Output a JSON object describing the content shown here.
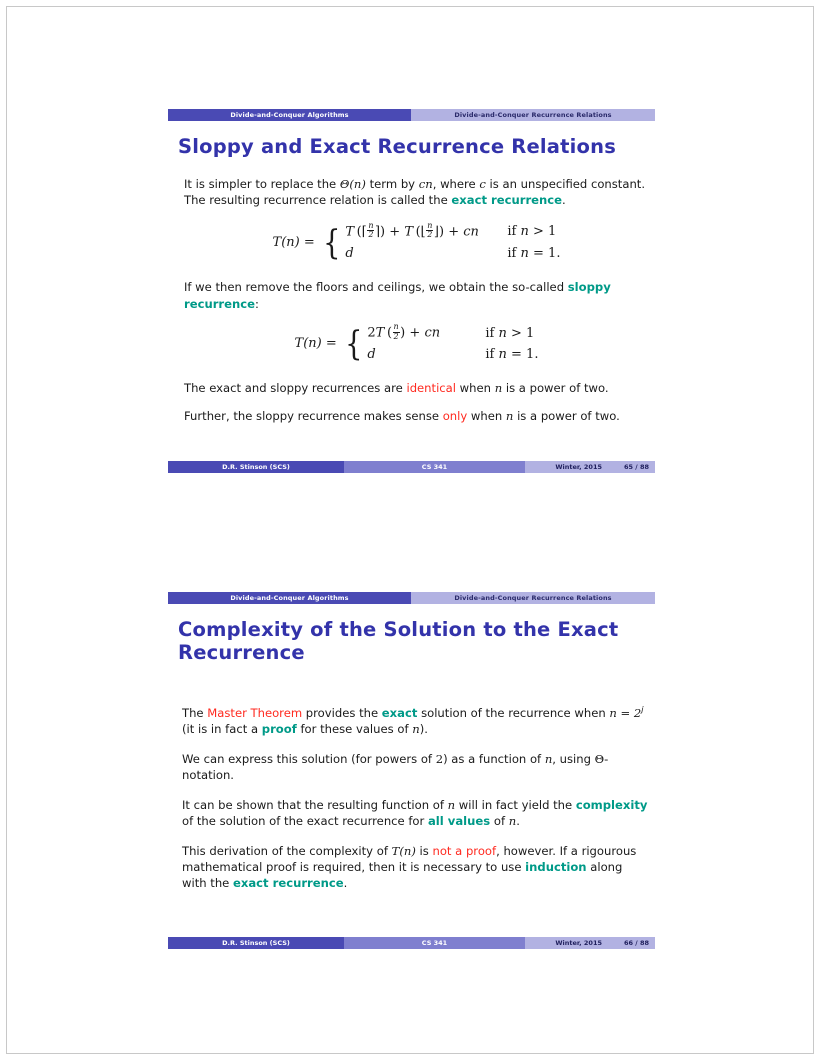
{
  "document": {
    "type": "lecture-slides",
    "colors": {
      "nav_active": "#4a4ab4",
      "nav_inactive": "#b2b2e2",
      "footer_author": "#4a4ab4",
      "footer_course": "#7f7fcf",
      "footer_right": "#b2b2e2",
      "title": "#3333aa",
      "highlight_teal": "#009a88",
      "highlight_red": "#ff2a20"
    }
  },
  "slide1": {
    "nav": {
      "active_label": "Divide-and-Conquer Algorithms",
      "inactive_label": "Divide-and-Conquer Recurrence Relations"
    },
    "title": "Sloppy and Exact Recurrence Relations",
    "para1": {
      "seg1": "It is simpler to replace the ",
      "theta": "Θ(n)",
      "seg2": " term by ",
      "cn": "cn",
      "seg3": ", where ",
      "c": "c",
      "seg4": " is an unspecified constant. The resulting recurrence relation is called the ",
      "highlight": "exact recurrence",
      "seg5": "."
    },
    "equation_exact": {
      "lhs": "T(n) =",
      "case1": "T (⌈n/2⌉) + T (⌊n/2⌋) + cn",
      "cond1": "if n > 1",
      "case2": "d",
      "cond2": "if n = 1.",
      "T": "T",
      "plus": "+",
      "cn": "cn",
      "d": "d",
      "lceil": "⌈",
      "rceil": "⌉",
      "lfloor": "⌊",
      "rfloor": "⌋",
      "num": "n",
      "den": "2",
      "if": "if",
      "n": "n",
      "gt": "> 1",
      "eq": "= 1."
    },
    "para2": {
      "seg1": "If we then remove the floors and ceilings, we obtain the so-called ",
      "highlight": "sloppy recurrence",
      "seg2": ":"
    },
    "equation_sloppy": {
      "lhs": "T(n) =",
      "case1": "2 T (n/2) + cn",
      "cond1": "if n > 1",
      "case2": "d",
      "cond2": "if n = 1.",
      "two": "2",
      "T": "T",
      "plus": "+",
      "cn": "cn",
      "d": "d",
      "num": "n",
      "den": "2",
      "if": "if",
      "n": "n",
      "gt": "> 1",
      "eq": "= 1."
    },
    "para3": {
      "seg1": "The exact and sloppy recurrences are ",
      "highlight": "identical",
      "seg2": " when ",
      "n": "n",
      "seg3": " is a power of two."
    },
    "para4": {
      "seg1": "Further, the sloppy recurrence makes sense ",
      "highlight": "only",
      "seg2": " when ",
      "n": "n",
      "seg3": " is a power of two."
    },
    "footer": {
      "author": "D.R. Stinson  (SCS)",
      "course": "CS 341",
      "term": "Winter, 2015",
      "page": "65 / 88"
    }
  },
  "slide2": {
    "nav": {
      "active_label": "Divide-and-Conquer Algorithms",
      "inactive_label": "Divide-and-Conquer Recurrence Relations"
    },
    "title": "Complexity of the Solution to the Exact Recurrence",
    "para1": {
      "seg1": "The ",
      "red": "Master Theorem",
      "seg2": " provides the ",
      "teal1": "exact",
      "seg3": " solution of the recurrence when ",
      "math1": "n = 2",
      "sup": "j",
      "seg4": " (it is in fact a ",
      "teal2": "proof",
      "seg5": " for these values of ",
      "n": "n",
      "seg6": ")."
    },
    "para2": {
      "seg1": "We can express this solution (for powers of ",
      "two": "2",
      "seg2": ") as a function of ",
      "n": "n",
      "seg3": ", using ",
      "theta": "Θ",
      "seg4": "-notation."
    },
    "para3": {
      "seg1": "It can be shown that the resulting function of ",
      "n1": "n",
      "seg2": " will in fact yield the ",
      "teal1": "complexity",
      "seg3": " of the solution of the exact recurrence for ",
      "teal2": "all values",
      "seg4": " of ",
      "n2": "n",
      "seg5": "."
    },
    "para4": {
      "seg1": "This derivation of the complexity of ",
      "math": "T(n)",
      "seg2": " is ",
      "red": "not a proof",
      "seg3": ", however. If a rigourous mathematical proof is required, then it is necessary to use ",
      "teal1": "induction",
      "seg4": " along with the ",
      "teal2": "exact recurrence",
      "seg5": "."
    },
    "footer": {
      "author": "D.R. Stinson  (SCS)",
      "course": "CS 341",
      "term": "Winter, 2015",
      "page": "66 / 88"
    }
  }
}
